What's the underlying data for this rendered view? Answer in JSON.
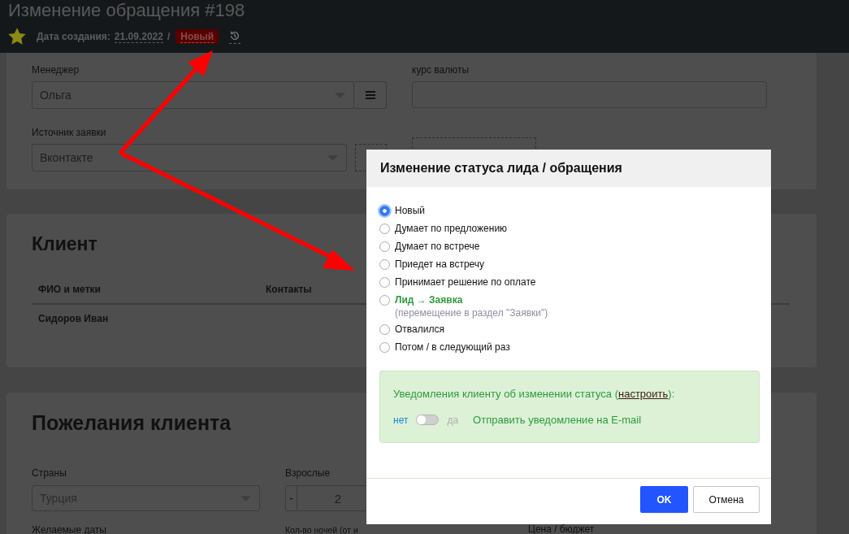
{
  "header": {
    "title": "Изменение обращения #198",
    "starred": true,
    "created_label": "Дата создания:",
    "created_date": "21.09.2022",
    "separator": "/",
    "status": "Новый"
  },
  "manager": {
    "label": "Менеджер",
    "value": "Ольга"
  },
  "exchange_rate": {
    "label": "курс валюты"
  },
  "source": {
    "label": "Источник заявки",
    "value": "Вконтакте"
  },
  "client": {
    "title": "Клиент",
    "columns": [
      "ФИО и метки",
      "Контакты"
    ],
    "rows": [
      [
        "Сидоров Иван"
      ]
    ]
  },
  "wishes": {
    "title": "Пожелания клиента",
    "countries": {
      "label": "Страны",
      "value": "Турция"
    },
    "adults": {
      "label": "Взрослые",
      "minus": "-",
      "value": "2"
    },
    "dates": {
      "label": "Желаемые даты"
    },
    "nights": {
      "label": "Кол-во ночей (от и"
    },
    "price": {
      "label": "Цена / бюджет"
    }
  },
  "dialog": {
    "title": "Изменение статуса лида / обращения",
    "options": [
      {
        "label": "Новый",
        "kind": "plain",
        "selected": true
      },
      {
        "label": "Думает по предложению",
        "kind": "plain",
        "selected": false
      },
      {
        "label": "Думает по встрече",
        "kind": "plain",
        "selected": false
      },
      {
        "label": "Приедет на встречу",
        "kind": "plain",
        "selected": false
      },
      {
        "label": "Принимает решение по оплате",
        "kind": "plain",
        "selected": false
      },
      {
        "label": "Лид → Заявка",
        "note": "(перемещение в раздел \"Заявки\")",
        "kind": "convert",
        "selected": false
      },
      {
        "label": "Отвалился",
        "kind": "plain",
        "selected": false
      },
      {
        "label": "Потом / в следующий раз",
        "kind": "plain",
        "selected": false
      }
    ],
    "notify": {
      "text_before": "Уведомления клиенту об изменении статуса (",
      "link": "настроить",
      "text_after": "):",
      "off_label": "нет",
      "on_label": "да",
      "on": false,
      "action": "Отправить уведомление на E-mail"
    },
    "buttons": {
      "ok": "OK",
      "cancel": "Отмена"
    }
  }
}
